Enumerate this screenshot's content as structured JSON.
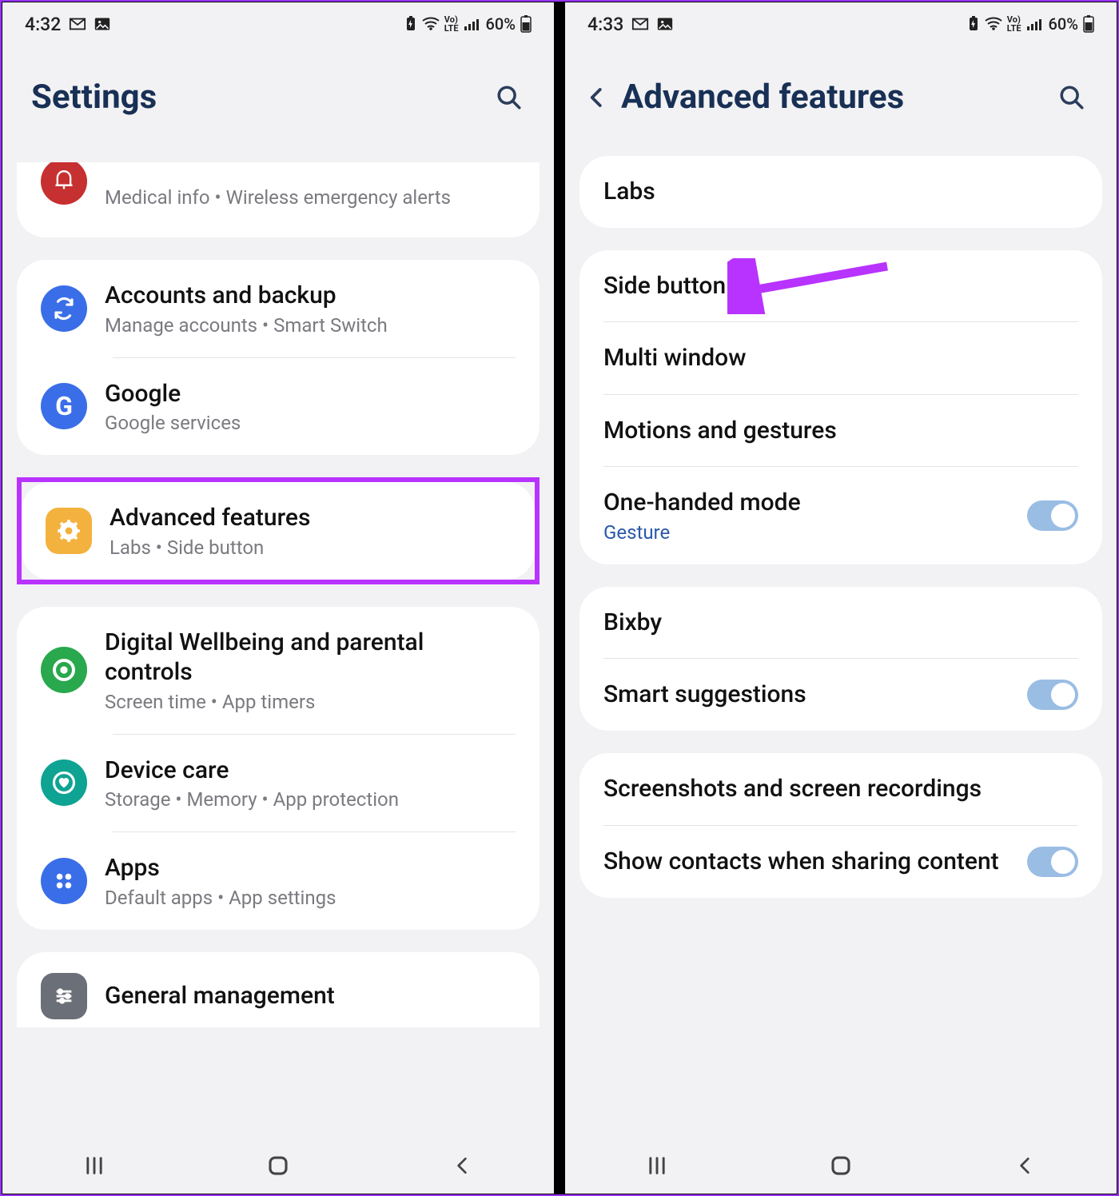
{
  "left": {
    "status": {
      "time": "4:32",
      "battery": "60%"
    },
    "title": "Settings",
    "partial_top": {
      "subtitle": "Medical info  •  Wireless emergency alerts"
    },
    "group1": [
      {
        "icon": "sync-icon",
        "color": "#3a6ee8",
        "title": "Accounts and backup",
        "subtitle": "Manage accounts  •  Smart Switch"
      },
      {
        "icon": "google-icon",
        "color": "#3a6ee8",
        "title": "Google",
        "subtitle": "Google services"
      }
    ],
    "highlighted": {
      "icon": "gear-filled-icon",
      "color": "#f3b23e",
      "title": "Advanced features",
      "subtitle": "Labs  •  Side button"
    },
    "group2": [
      {
        "icon": "target-dot-icon",
        "color": "#29a84d",
        "title": "Digital Wellbeing and parental controls",
        "subtitle": "Screen time  •  App timers"
      },
      {
        "icon": "heart-circle-icon",
        "color": "#0ea393",
        "title": "Device care",
        "subtitle": "Storage  •  Memory  •  App protection"
      },
      {
        "icon": "apps-grid-icon",
        "color": "#3a6ee8",
        "title": "Apps",
        "subtitle": "Default apps  •  App settings"
      }
    ],
    "group3": [
      {
        "icon": "sliders-icon",
        "color": "#6b6f78",
        "title": "General management",
        "subtitle": ""
      }
    ]
  },
  "right": {
    "status": {
      "time": "4:33",
      "battery": "60%"
    },
    "title": "Advanced features",
    "group1": [
      {
        "title": "Labs"
      }
    ],
    "group2": [
      {
        "title": "Side button"
      },
      {
        "title": "Multi window"
      },
      {
        "title": "Motions and gestures"
      },
      {
        "title": "One-handed mode",
        "subtitle": "Gesture",
        "toggle": true
      }
    ],
    "group3": [
      {
        "title": "Bixby"
      },
      {
        "title": "Smart suggestions",
        "toggle": true
      }
    ],
    "group4": [
      {
        "title": "Screenshots and screen recordings"
      },
      {
        "title": "Show contacts when sharing content",
        "toggle": true
      }
    ]
  }
}
